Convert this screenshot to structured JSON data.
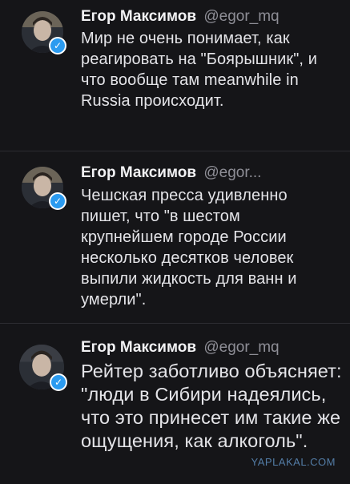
{
  "tweets": [
    {
      "author_name": "Егор Максимов",
      "handle": "@egor_mq",
      "verified": true,
      "text": "Мир не очень понимает, как реагировать на \"Боярышник\", и что вообще там meanwhile in Russia происходит."
    },
    {
      "author_name": "Егор Максимов",
      "handle": "@egor...",
      "verified": true,
      "text": "Чешская пресса удивленно пишет, что \"в шестом крупнейшем городе России несколько десятков человек выпили жидкость для ванн и умерли\"."
    },
    {
      "author_name": "Егор Максимов",
      "handle": "@egor_mq",
      "verified": true,
      "text": "Рейтер заботливо объясняет: \"люди в Сибири надеялись, что это принесет им такие же ощущения, как алкоголь\"."
    }
  ],
  "watermark": "YAPLAKAL.COM",
  "colors": {
    "background": "#151518",
    "divider": "#2c2c31",
    "verified_badge": "#2b9bf0",
    "handle": "#8e8e96"
  },
  "icons": {
    "verified": "verified-badge-icon",
    "avatar": "user-avatar"
  }
}
